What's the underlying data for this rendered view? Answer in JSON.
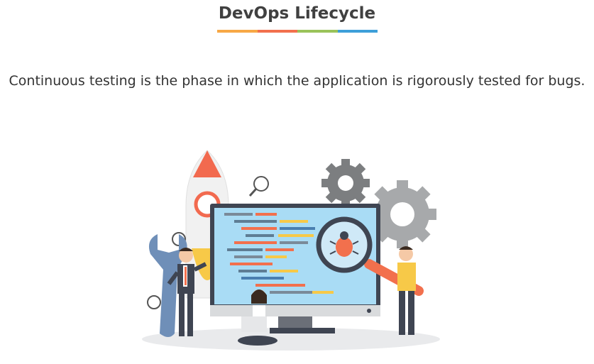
{
  "slide": {
    "title": "DevOps Lifecycle",
    "caption": "Continuous testing is the phase in which the application is rigorously tested for bugs."
  },
  "colors": {
    "underline": [
      "#f7a845",
      "#f2704d",
      "#9ac35a",
      "#3d9fd9"
    ],
    "gear": "#7c7e80",
    "gear_light": "#a7a9ab",
    "monitor_frame": "#3f4552",
    "screen": "#a9dcf5",
    "rocket_tip": "#f26a4f",
    "accent_orange": "#f2704d",
    "wrench": "#6f8fb8",
    "floor": "#e9eaec"
  },
  "icons": [
    "rocket-icon",
    "gear-icon",
    "magnifier-icon",
    "bug-icon",
    "wrench-icon"
  ]
}
